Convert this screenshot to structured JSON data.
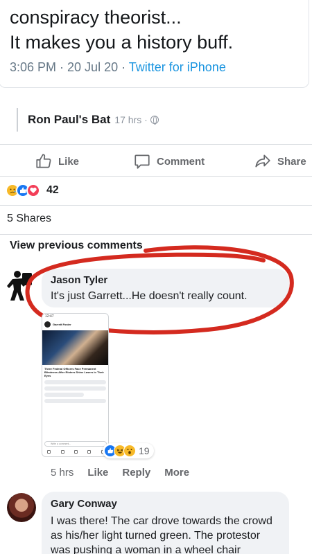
{
  "tweet": {
    "line1": "conspiracy theorist...",
    "line2": "It makes you a history buff.",
    "time": "3:06 PM · 20 Jul 20 · ",
    "source": "Twitter for iPhone"
  },
  "shared": {
    "name": "Ron Paul's Bat",
    "time": "17 hrs ·"
  },
  "actions": {
    "like": "Like",
    "comment": "Comment",
    "share": "Share"
  },
  "reactions": {
    "count": "42",
    "icons": [
      "sad-reaction",
      "like-reaction",
      "love-reaction"
    ]
  },
  "shares": "5 Shares",
  "view_previous": "View previous comments",
  "comments": [
    {
      "name": "Jason Tyler",
      "text": "It's just Garrett...He doesn't really count.",
      "time": "5 hrs",
      "like": "Like",
      "reply": "Reply",
      "more": "More",
      "reaction_count": "19",
      "attachment": {
        "status_time": "12:47",
        "header_name": "Garrett Foster",
        "caption": "Three Federal Officers Face Permanent Blindness After Rioters Shine Lasers in Their Eyes",
        "comment_placeholder": "Write a comment..."
      }
    },
    {
      "name": "Gary Conway",
      "text": "I was there! The car drove towards the crowd as his/her light turned green. The protestor was pushing a woman in a wheel chair towards..."
    }
  ],
  "colors": {
    "link_blue": "#1b95e0",
    "meta_gray": "#657786",
    "bubble": "#f0f2f5",
    "annotation_red": "#d42a1f"
  }
}
